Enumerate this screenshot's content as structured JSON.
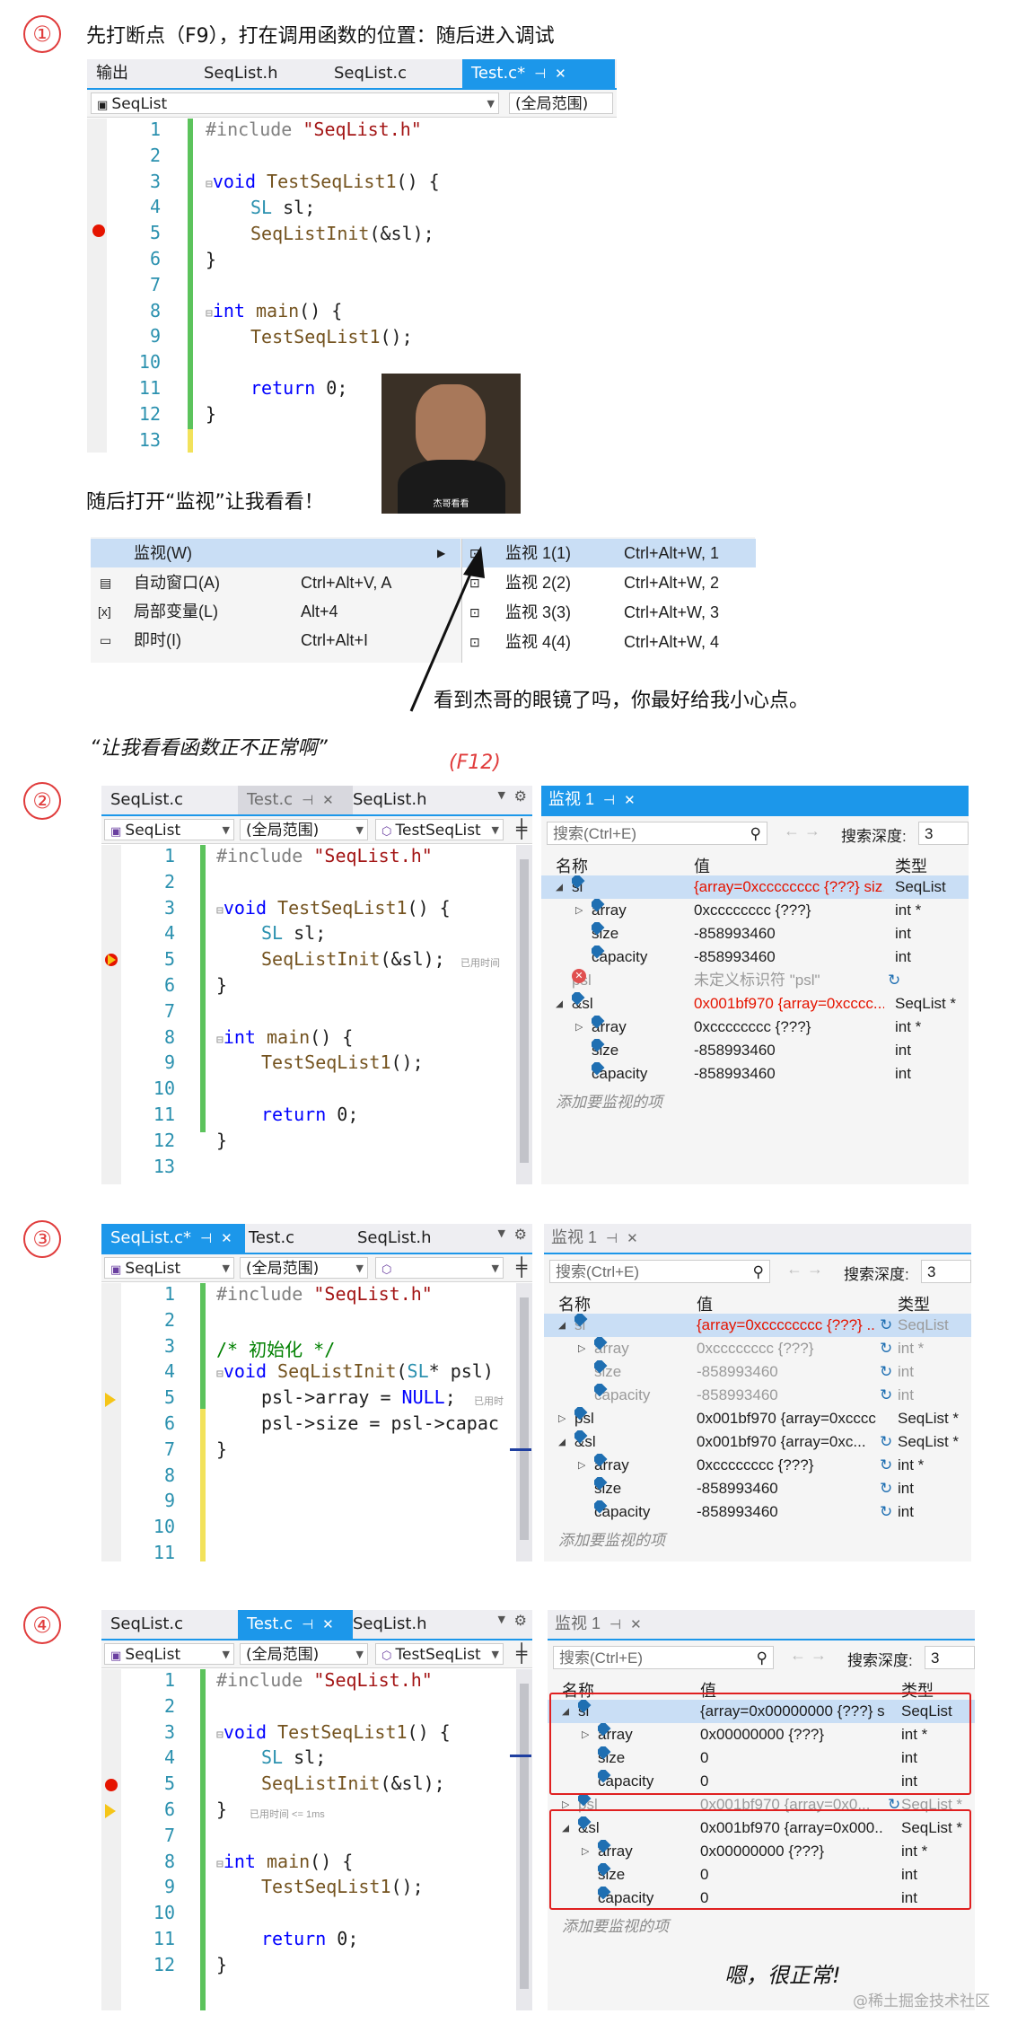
{
  "captions": {
    "step1_num": "①",
    "step1_text": "先打断点（F9），打在调用函数的位置：随后进入调试",
    "open_watch_text": "随后打开“监视”让我看看！",
    "meme_text": "看到杰哥的眼镜了吗，你最好给我小心点。",
    "quote_text": "“让我看看函数正不正常啊”",
    "f12": "(F12)",
    "step2_num": "②",
    "step3_num": "③",
    "step4_num": "④",
    "ok_text": "嗯，很正常!",
    "watermark": "@稀土掘金技术社区"
  },
  "panel1": {
    "tabs": [
      "输出",
      "SeqList.h",
      "SeqList.c",
      "Test.c*"
    ],
    "nav_left": "SeqList",
    "nav_right": "(全局范围)",
    "line_numbers": [
      "1",
      "2",
      "3",
      "4",
      "5",
      "6",
      "7",
      "8",
      "9",
      "10",
      "11",
      "12",
      "13"
    ]
  },
  "code_test": {
    "l1a": "#include ",
    "l1b": "\"SeqList.h\"",
    "l3a": "void ",
    "l3b": "TestSeqList1",
    "l3c": "() {",
    "l4a": "SL ",
    "l4b": "sl;",
    "l5a": "SeqListInit",
    "l5b": "(&sl);",
    "l6": "}",
    "l8a": "int ",
    "l8b": "main",
    "l8c": "() {",
    "l9a": "TestSeqList1",
    "l9b": "();",
    "l11a": "return ",
    "l11b": "0;",
    "l12": "}"
  },
  "meme_image_caption": "杰哥看看",
  "menu": {
    "items": [
      {
        "label": "监视(W)",
        "shortcut": ""
      },
      {
        "label": "自动窗口(A)",
        "shortcut": "Ctrl+Alt+V, A"
      },
      {
        "label": "局部变量(L)",
        "shortcut": "Alt+4"
      },
      {
        "label": "即时(I)",
        "shortcut": "Ctrl+Alt+I"
      }
    ],
    "sub": [
      {
        "label": "监视 1(1)",
        "shortcut": "Ctrl+Alt+W, 1"
      },
      {
        "label": "监视 2(2)",
        "shortcut": "Ctrl+Alt+W, 2"
      },
      {
        "label": "监视 3(3)",
        "shortcut": "Ctrl+Alt+W, 3"
      },
      {
        "label": "监视 4(4)",
        "shortcut": "Ctrl+Alt+W, 4"
      }
    ]
  },
  "panel2": {
    "tabs": [
      "SeqList.c",
      "Test.c",
      "SeqList.h"
    ],
    "nav": [
      "SeqList",
      "(全局范围)",
      "TestSeqList"
    ],
    "hint": "已用时间",
    "watch_title": "监视 1",
    "search": "搜索(Ctrl+E)",
    "depth_label": "搜索深度:",
    "depth": "3",
    "cols": [
      "名称",
      "值",
      "类型"
    ],
    "rows": [
      {
        "name": "sl",
        "value": "{array=0xcccccccc {???} siz...",
        "type": "SeqList"
      },
      {
        "name": "array",
        "value": "0xcccccccc {???}",
        "type": "int *"
      },
      {
        "name": "size",
        "value": "-858993460",
        "type": "int"
      },
      {
        "name": "capacity",
        "value": "-858993460",
        "type": "int"
      },
      {
        "name": "psl",
        "value": "未定义标识符 \"psl\"",
        "type": ""
      },
      {
        "name": "&sl",
        "value": "0x001bf970 {array=0xcccc...",
        "type": "SeqList *"
      },
      {
        "name": "array",
        "value": "0xcccccccc {???}",
        "type": "int *"
      },
      {
        "name": "size",
        "value": "-858993460",
        "type": "int"
      },
      {
        "name": "capacity",
        "value": "-858993460",
        "type": "int"
      }
    ],
    "add_watch": "添加要监视的项"
  },
  "panel3": {
    "tabs": [
      "SeqList.c*",
      "Test.c",
      "SeqList.h"
    ],
    "nav": [
      "SeqList",
      "(全局范围)",
      ""
    ],
    "hint": "已用时",
    "code": {
      "l1a": "#include ",
      "l1b": "\"SeqList.h\"",
      "l3": "/* 初始化 */",
      "l4a": "void ",
      "l4b": "SeqListInit",
      "l4c": "(",
      "l4d": "SL",
      "l4e": "* psl)",
      "l5a": "psl->array = ",
      "l5b": "NULL",
      "l5c": ";",
      "l6": "psl->size = psl->capac",
      "l7": "}"
    },
    "line_numbers": [
      "1",
      "2",
      "3",
      "4",
      "5",
      "6",
      "7",
      "8",
      "9",
      "10",
      "11"
    ],
    "watch_title": "监视 1",
    "search": "搜索(Ctrl+E)",
    "depth_label": "搜索深度:",
    "depth": "3",
    "cols": [
      "名称",
      "值",
      "类型"
    ],
    "rows": [
      {
        "name": "sl",
        "value": "{array=0xcccccccc {???} ...",
        "type": "SeqList"
      },
      {
        "name": "array",
        "value": "0xcccccccc {???}",
        "type": "int *"
      },
      {
        "name": "size",
        "value": "-858993460",
        "type": "int"
      },
      {
        "name": "capacity",
        "value": "-858993460",
        "type": "int"
      },
      {
        "name": "psl",
        "value": "0x001bf970 {array=0xcccc...",
        "type": "SeqList *"
      },
      {
        "name": "&sl",
        "value": "0x001bf970 {array=0xc...",
        "type": "SeqList *"
      },
      {
        "name": "array",
        "value": "0xcccccccc {???}",
        "type": "int *"
      },
      {
        "name": "size",
        "value": "-858993460",
        "type": "int"
      },
      {
        "name": "capacity",
        "value": "-858993460",
        "type": "int"
      }
    ],
    "add_watch": "添加要监视的项"
  },
  "panel4": {
    "tabs": [
      "SeqList.c",
      "Test.c",
      "SeqList.h"
    ],
    "nav": [
      "SeqList",
      "(全局范围)",
      "TestSeqList"
    ],
    "hint": "已用时间 <= 1ms",
    "line_numbers": [
      "1",
      "2",
      "3",
      "4",
      "5",
      "6",
      "7",
      "8",
      "9",
      "10",
      "11",
      "12"
    ],
    "watch_title": "监视 1",
    "search": "搜索(Ctrl+E)",
    "depth_label": "搜索深度:",
    "depth": "3",
    "cols": [
      "名称",
      "值",
      "类型"
    ],
    "rows": [
      {
        "name": "sl",
        "value": "{array=0x00000000 {???} s...",
        "type": "SeqList"
      },
      {
        "name": "array",
        "value": "0x00000000 {???}",
        "type": "int *"
      },
      {
        "name": "size",
        "value": "0",
        "type": "int"
      },
      {
        "name": "capacity",
        "value": "0",
        "type": "int"
      },
      {
        "name": "psl",
        "value": "0x001bf970 {array=0x0...",
        "type": "SeqList *"
      },
      {
        "name": "&sl",
        "value": "0x001bf970 {array=0x000...",
        "type": "SeqList *"
      },
      {
        "name": "array",
        "value": "0x00000000 {???}",
        "type": "int *"
      },
      {
        "name": "size",
        "value": "0",
        "type": "int"
      },
      {
        "name": "capacity",
        "value": "0",
        "type": "int"
      }
    ],
    "add_watch": "添加要监视的项"
  },
  "colors": {
    "accent": "#1c97ea",
    "breakpoint": "#e51400",
    "changed_value": "#e51400",
    "highlight_box": "#e02020"
  }
}
